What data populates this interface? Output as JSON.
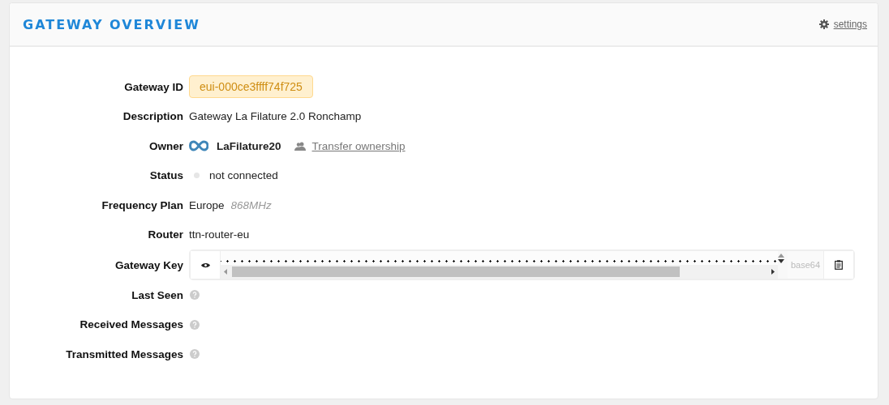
{
  "header": {
    "title": "GATEWAY OVERVIEW",
    "settings_link": "settings"
  },
  "rows": [
    {
      "kind": "badge",
      "label": "Gateway ID",
      "value": "eui-000ce3ffff74f725"
    },
    {
      "kind": "text",
      "label": "Description",
      "value": "Gateway La Filature 2.0 Ronchamp"
    },
    {
      "kind": "owner",
      "label": "Owner",
      "value": "LaFilature20",
      "link": "Transfer ownership"
    },
    {
      "kind": "status",
      "label": "Status",
      "value": "not connected",
      "connected": false
    },
    {
      "kind": "frequency",
      "label": "Frequency Plan",
      "value": "Europe",
      "band": "868MHz"
    },
    {
      "kind": "text",
      "label": "Router",
      "value": "ttn-router-eu"
    },
    {
      "kind": "key",
      "label": "Gateway Key",
      "encoding": "base64"
    },
    {
      "kind": "help",
      "label": "Last Seen"
    },
    {
      "kind": "help",
      "label": "Received Messages"
    },
    {
      "kind": "help",
      "label": "Transmitted Messages"
    }
  ]
}
